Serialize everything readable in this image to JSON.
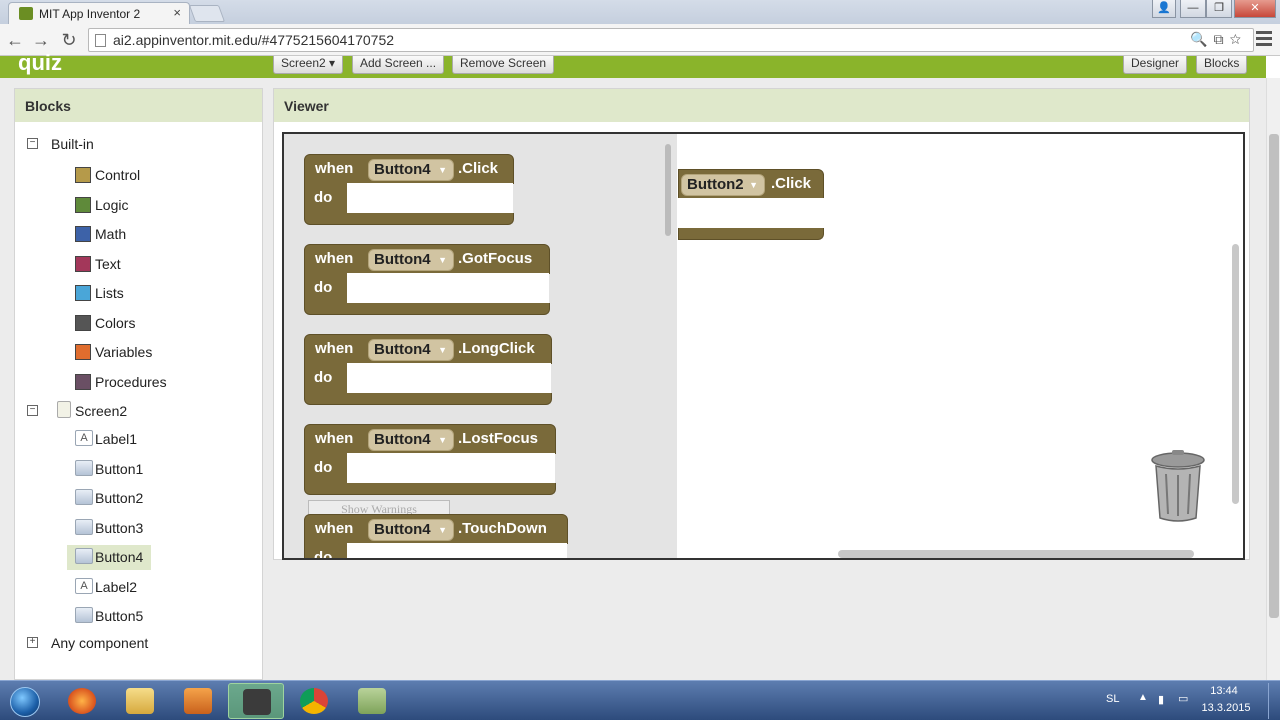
{
  "browser": {
    "tab_title": "MIT App Inventor 2",
    "tab_close": "×",
    "url": "ai2.appinventor.mit.edu/#4775215604170752"
  },
  "header": {
    "project_name": "quiz",
    "screen_dropdown": "Screen2 ▾",
    "add_screen": "Add Screen ...",
    "remove_screen": "Remove Screen",
    "designer": "Designer",
    "blocks": "Blocks",
    "accent_color": "#8ab42b"
  },
  "blocks_panel": {
    "title": "Blocks",
    "builtin_label": "Built-in",
    "builtin_items": [
      {
        "label": "Control",
        "color": "#b59a4a"
      },
      {
        "label": "Logic",
        "color": "#5f8a3a"
      },
      {
        "label": "Math",
        "color": "#3d62a8"
      },
      {
        "label": "Text",
        "color": "#a3375a"
      },
      {
        "label": "Lists",
        "color": "#4aa6d8"
      },
      {
        "label": "Colors",
        "color": "#555555"
      },
      {
        "label": "Variables",
        "color": "#e06d2e"
      },
      {
        "label": "Procedures",
        "color": "#6a4f64"
      }
    ],
    "screen_label": "Screen2",
    "components": [
      {
        "label": "Label1",
        "icon": "label-icon"
      },
      {
        "label": "Button1",
        "icon": "button-icon"
      },
      {
        "label": "Button2",
        "icon": "button-icon"
      },
      {
        "label": "Button3",
        "icon": "button-icon"
      },
      {
        "label": "Button4",
        "icon": "button-icon"
      },
      {
        "label": "Label2",
        "icon": "label-icon"
      },
      {
        "label": "Button5",
        "icon": "button-icon"
      }
    ],
    "any_component": "Any component"
  },
  "viewer": {
    "title": "Viewer",
    "block_color": "#7a6a3a",
    "flyout_events": [
      {
        "when": "when",
        "component": "Button4",
        "event": ".Click",
        "do": "do"
      },
      {
        "when": "when",
        "component": "Button4",
        "event": ".GotFocus",
        "do": "do"
      },
      {
        "when": "when",
        "component": "Button4",
        "event": ".LongClick",
        "do": "do"
      },
      {
        "when": "when",
        "component": "Button4",
        "event": ".LostFocus",
        "do": "do"
      },
      {
        "when": "when",
        "component": "Button4",
        "event": ".TouchDown",
        "do": "do"
      }
    ],
    "workspace_block": {
      "component": "Button2",
      "event": ".Click"
    },
    "show_warnings": "Show Warnings"
  },
  "taskbar": {
    "language": "SL",
    "time": "13:44",
    "date": "13.3.2015"
  }
}
